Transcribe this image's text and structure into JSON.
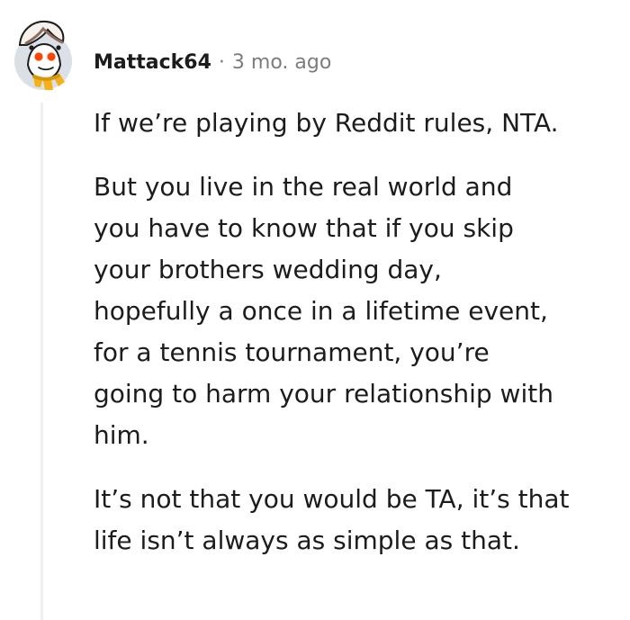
{
  "comment": {
    "author": "Mattack64",
    "separator": "·",
    "timestamp": "3 mo. ago",
    "avatar_icon": "snoo-avatar-icon",
    "paragraphs": [
      {
        "lines": [
          "If we’re playing by Reddit rules, NTA."
        ]
      },
      {
        "lines": [
          "But you live in the real world and",
          "you have to know that if you skip",
          "your brothers wedding day,",
          "hopefully a once in a lifetime event,",
          "for a tennis tournament, you’re",
          "going to harm your relationship with",
          "him."
        ]
      },
      {
        "lines": [
          "It’s not that you would be TA, it’s that",
          "life isn’t always as simple as that."
        ]
      }
    ]
  },
  "colors": {
    "text": "#1c1c1c",
    "meta": "#7c7c7c",
    "thread_line": "#edeff1",
    "snoo_eye": "#ff4500",
    "avatar_bg": "#dae0e6",
    "scarf": "#f5b11a"
  }
}
